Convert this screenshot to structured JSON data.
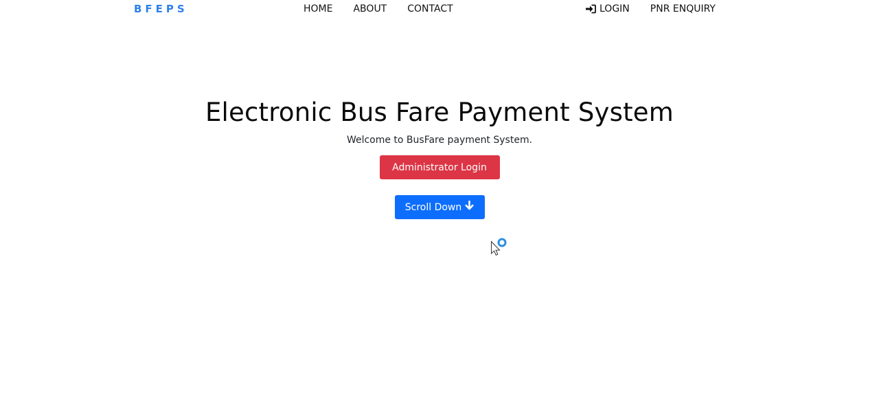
{
  "navbar": {
    "brand": "BFEPS",
    "links_center": [
      {
        "label": "HOME"
      },
      {
        "label": "ABOUT"
      },
      {
        "label": "CONTACT"
      }
    ],
    "links_right": [
      {
        "label": "LOGIN",
        "icon": "sign-in-icon"
      },
      {
        "label": "PNR ENQUIRY"
      }
    ]
  },
  "hero": {
    "title": "Electronic Bus Fare Payment System",
    "subtitle": "Welcome to BusFare payment System.",
    "admin_button_label": "Administrator Login",
    "scroll_button_label": "Scroll Down",
    "scroll_button_icon": "arrow-down-icon"
  },
  "colors": {
    "brand": "#2f80ed",
    "admin_button": "#dc3545",
    "scroll_button": "#0d6efd"
  },
  "cursor": {
    "icon": "busy-cursor-icon"
  }
}
